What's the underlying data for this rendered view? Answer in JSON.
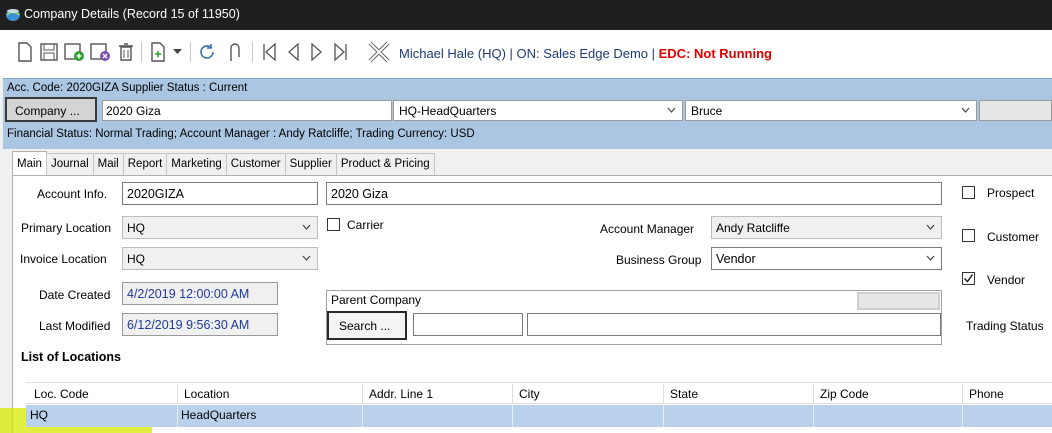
{
  "window": {
    "title": "Company Details  (Record 15 of 11950)"
  },
  "toolbar": {
    "icons": [
      "new-icon",
      "save-icon",
      "save-new-icon",
      "save-close-icon",
      "delete-icon",
      "add-dropdown-icon",
      "refresh-icon",
      "attach-icon",
      "first-record-icon",
      "prev-record-icon",
      "next-record-icon",
      "last-record-icon",
      "cancel-icon"
    ],
    "status_text": "Michael Hale (HQ) | ON: Sales Edge Demo | ",
    "edc_text": "EDC: Not Running"
  },
  "header": {
    "line1": "Acc. Code: 2020GIZA  Supplier Status : Current",
    "company_button": "Company ...",
    "company_name": "2020 Giza",
    "location": "HQ-HeadQuarters",
    "account_manager_short": "Bruce",
    "line3": "Financial Status: Normal Trading;  Account Manager : Andy Ratcliffe; Trading Currency: USD"
  },
  "tabs": [
    "Main",
    "Journal",
    "Mail",
    "Report",
    "Marketing",
    "Customer",
    "Supplier",
    "Product & Pricing"
  ],
  "form": {
    "account_info_label": "Account Info.",
    "account_info_code": "2020GIZA",
    "account_info_name": "2020 Giza",
    "primary_location_label": "Primary Location",
    "primary_location_value": "HQ",
    "carrier_label": "Carrier",
    "account_manager_label": "Account Manager",
    "account_manager_value": "Andy Ratcliffe",
    "invoice_location_label": "Invoice Location",
    "invoice_location_value": "HQ",
    "business_group_label": "Business Group",
    "business_group_value": "Vendor",
    "date_created_label": "Date Created",
    "date_created_value": "4/2/2019 12:00:00 AM",
    "last_modified_label": "Last Modified",
    "last_modified_value": "6/12/2019 9:56:30 AM",
    "parent_company_label": "Parent Company",
    "search_button": "Search ...",
    "prospect_label": "Prospect",
    "customer_label": "Customer",
    "vendor_label": "Vendor",
    "prospect_checked": false,
    "customer_checked": false,
    "vendor_checked": true,
    "trading_status_label": "Trading Status"
  },
  "locations": {
    "title": "List of Locations",
    "columns": [
      "Loc. Code",
      "Location",
      "Addr. Line 1",
      "City",
      "State",
      "Zip Code",
      "Phone"
    ],
    "rows": [
      {
        "loc_code": "HQ",
        "location": "HeadQuarters",
        "addr1": "",
        "city": "",
        "state": "",
        "zip": "",
        "phone": ""
      }
    ]
  },
  "colors": {
    "titlebar": "#1f1f1f",
    "header_panel": "#aac6e2",
    "selected_row": "#b9d1ea",
    "edc_red": "#e00000",
    "highlight": "#d7eb00"
  }
}
